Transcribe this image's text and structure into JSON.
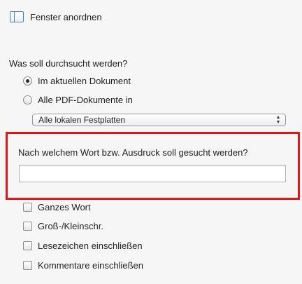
{
  "arrange": {
    "icon": "window-layout-icon",
    "label": "Fenster anordnen"
  },
  "search_scope": {
    "title": "Was soll durchsucht werden?",
    "options": [
      {
        "label": "Im aktuellen Dokument",
        "checked": true
      },
      {
        "label": "Alle PDF-Dokumente in",
        "checked": false
      }
    ],
    "location_select": {
      "value": "Alle lokalen Festplatten"
    }
  },
  "search_term": {
    "question": "Nach welchem Wort bzw. Ausdruck soll gesucht werden?",
    "value": "",
    "highlight_color": "#e2161b"
  },
  "options": [
    {
      "label": "Ganzes Wort",
      "checked": false
    },
    {
      "label": "Groß-/Kleinschr.",
      "checked": false
    },
    {
      "label": "Lesezeichen einschließen",
      "checked": false
    },
    {
      "label": "Kommentare einschließen",
      "checked": false
    }
  ]
}
